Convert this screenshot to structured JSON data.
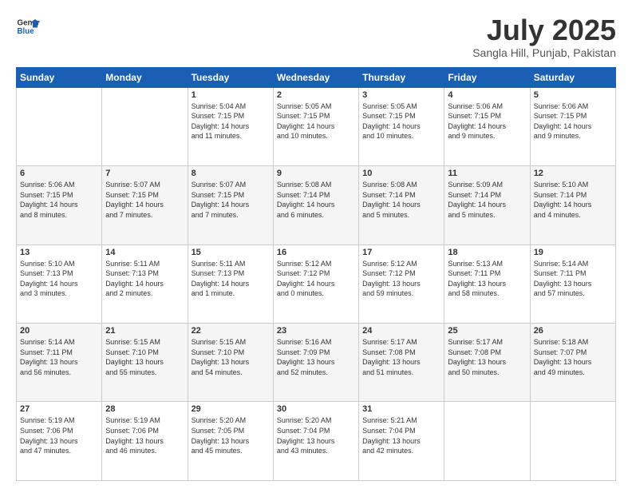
{
  "header": {
    "logo_line1": "General",
    "logo_line2": "Blue",
    "title": "July 2025",
    "subtitle": "Sangla Hill, Punjab, Pakistan"
  },
  "weekdays": [
    "Sunday",
    "Monday",
    "Tuesday",
    "Wednesday",
    "Thursday",
    "Friday",
    "Saturday"
  ],
  "weeks": [
    [
      {
        "day": "",
        "info": ""
      },
      {
        "day": "",
        "info": ""
      },
      {
        "day": "1",
        "info": "Sunrise: 5:04 AM\nSunset: 7:15 PM\nDaylight: 14 hours\nand 11 minutes."
      },
      {
        "day": "2",
        "info": "Sunrise: 5:05 AM\nSunset: 7:15 PM\nDaylight: 14 hours\nand 10 minutes."
      },
      {
        "day": "3",
        "info": "Sunrise: 5:05 AM\nSunset: 7:15 PM\nDaylight: 14 hours\nand 10 minutes."
      },
      {
        "day": "4",
        "info": "Sunrise: 5:06 AM\nSunset: 7:15 PM\nDaylight: 14 hours\nand 9 minutes."
      },
      {
        "day": "5",
        "info": "Sunrise: 5:06 AM\nSunset: 7:15 PM\nDaylight: 14 hours\nand 9 minutes."
      }
    ],
    [
      {
        "day": "6",
        "info": "Sunrise: 5:06 AM\nSunset: 7:15 PM\nDaylight: 14 hours\nand 8 minutes."
      },
      {
        "day": "7",
        "info": "Sunrise: 5:07 AM\nSunset: 7:15 PM\nDaylight: 14 hours\nand 7 minutes."
      },
      {
        "day": "8",
        "info": "Sunrise: 5:07 AM\nSunset: 7:15 PM\nDaylight: 14 hours\nand 7 minutes."
      },
      {
        "day": "9",
        "info": "Sunrise: 5:08 AM\nSunset: 7:14 PM\nDaylight: 14 hours\nand 6 minutes."
      },
      {
        "day": "10",
        "info": "Sunrise: 5:08 AM\nSunset: 7:14 PM\nDaylight: 14 hours\nand 5 minutes."
      },
      {
        "day": "11",
        "info": "Sunrise: 5:09 AM\nSunset: 7:14 PM\nDaylight: 14 hours\nand 5 minutes."
      },
      {
        "day": "12",
        "info": "Sunrise: 5:10 AM\nSunset: 7:14 PM\nDaylight: 14 hours\nand 4 minutes."
      }
    ],
    [
      {
        "day": "13",
        "info": "Sunrise: 5:10 AM\nSunset: 7:13 PM\nDaylight: 14 hours\nand 3 minutes."
      },
      {
        "day": "14",
        "info": "Sunrise: 5:11 AM\nSunset: 7:13 PM\nDaylight: 14 hours\nand 2 minutes."
      },
      {
        "day": "15",
        "info": "Sunrise: 5:11 AM\nSunset: 7:13 PM\nDaylight: 14 hours\nand 1 minute."
      },
      {
        "day": "16",
        "info": "Sunrise: 5:12 AM\nSunset: 7:12 PM\nDaylight: 14 hours\nand 0 minutes."
      },
      {
        "day": "17",
        "info": "Sunrise: 5:12 AM\nSunset: 7:12 PM\nDaylight: 13 hours\nand 59 minutes."
      },
      {
        "day": "18",
        "info": "Sunrise: 5:13 AM\nSunset: 7:11 PM\nDaylight: 13 hours\nand 58 minutes."
      },
      {
        "day": "19",
        "info": "Sunrise: 5:14 AM\nSunset: 7:11 PM\nDaylight: 13 hours\nand 57 minutes."
      }
    ],
    [
      {
        "day": "20",
        "info": "Sunrise: 5:14 AM\nSunset: 7:11 PM\nDaylight: 13 hours\nand 56 minutes."
      },
      {
        "day": "21",
        "info": "Sunrise: 5:15 AM\nSunset: 7:10 PM\nDaylight: 13 hours\nand 55 minutes."
      },
      {
        "day": "22",
        "info": "Sunrise: 5:15 AM\nSunset: 7:10 PM\nDaylight: 13 hours\nand 54 minutes."
      },
      {
        "day": "23",
        "info": "Sunrise: 5:16 AM\nSunset: 7:09 PM\nDaylight: 13 hours\nand 52 minutes."
      },
      {
        "day": "24",
        "info": "Sunrise: 5:17 AM\nSunset: 7:08 PM\nDaylight: 13 hours\nand 51 minutes."
      },
      {
        "day": "25",
        "info": "Sunrise: 5:17 AM\nSunset: 7:08 PM\nDaylight: 13 hours\nand 50 minutes."
      },
      {
        "day": "26",
        "info": "Sunrise: 5:18 AM\nSunset: 7:07 PM\nDaylight: 13 hours\nand 49 minutes."
      }
    ],
    [
      {
        "day": "27",
        "info": "Sunrise: 5:19 AM\nSunset: 7:06 PM\nDaylight: 13 hours\nand 47 minutes."
      },
      {
        "day": "28",
        "info": "Sunrise: 5:19 AM\nSunset: 7:06 PM\nDaylight: 13 hours\nand 46 minutes."
      },
      {
        "day": "29",
        "info": "Sunrise: 5:20 AM\nSunset: 7:05 PM\nDaylight: 13 hours\nand 45 minutes."
      },
      {
        "day": "30",
        "info": "Sunrise: 5:20 AM\nSunset: 7:04 PM\nDaylight: 13 hours\nand 43 minutes."
      },
      {
        "day": "31",
        "info": "Sunrise: 5:21 AM\nSunset: 7:04 PM\nDaylight: 13 hours\nand 42 minutes."
      },
      {
        "day": "",
        "info": ""
      },
      {
        "day": "",
        "info": ""
      }
    ]
  ]
}
